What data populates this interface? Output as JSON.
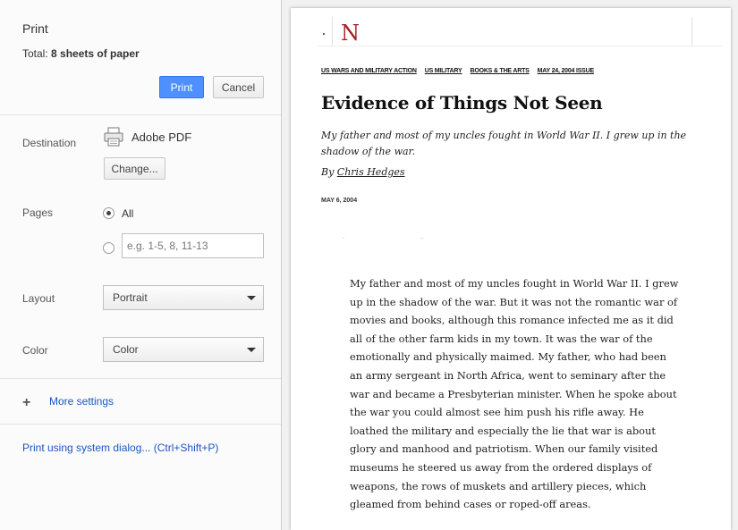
{
  "print_panel": {
    "title": "Print",
    "total_label": "Total: ",
    "total_value": "8 sheets of paper",
    "print_button": "Print",
    "cancel_button": "Cancel",
    "destination": {
      "label": "Destination",
      "printer": "Adobe PDF",
      "change_button": "Change..."
    },
    "pages": {
      "label": "Pages",
      "all_option": "All",
      "custom_placeholder": "e.g. 1-5, 8, 11-13",
      "selected": "All"
    },
    "layout": {
      "label": "Layout",
      "value": "Portrait"
    },
    "color": {
      "label": "Color",
      "value": "Color"
    },
    "more_settings": "More settings",
    "system_dialog_link": "Print using system dialog... (Ctrl+Shift+P)"
  },
  "preview": {
    "logo": "N",
    "categories": [
      "US WARS AND MILITARY ACTION",
      "US MILITARY",
      "BOOKS & THE ARTS",
      "MAY 24, 2004 ISSUE"
    ],
    "headline": "Evidence of Things Not Seen",
    "dek": "My father and most of my uncles fought in World War II. I grew up in the shadow of the war.",
    "byline_prefix": "By ",
    "author": "Chris Hedges",
    "date": "MAY 6, 2004",
    "body": "My father and most of my uncles fought in World War II. I grew up in the shadow of the war. But it was not the romantic war of movies and books, although this romance infected me as it did all of the other farm kids in my town. It was the war of the emotionally and physically maimed. My father, who had been an army sergeant in North Africa, went to seminary after the war and became a Presbyterian minister. When he spoke about the war you could almost see him push his rifle away. He loathed the military and especially the lie that war is about glory and manhood and patriotism. When our family visited museums he steered us away from the ordered displays of weapons, the rows of muskets and artillery pieces, which gleamed from behind cases or roped-off areas."
  },
  "colors": {
    "primary_button": "#4d90fe",
    "logo_red": "#a41e22",
    "link": "#1a56c4"
  }
}
